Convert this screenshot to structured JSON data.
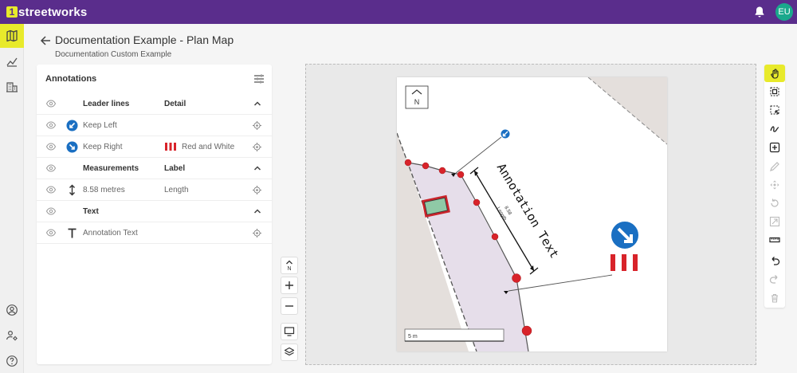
{
  "app": {
    "logo_mark": "1",
    "logo_text": "streetworks",
    "user_initials": "EU",
    "accent": "#5a2d8c",
    "highlight": "#e8ea2b"
  },
  "header": {
    "title": "Documentation Example - Plan Map",
    "subtitle": "Documentation Custom Example"
  },
  "panel": {
    "title": "Annotations",
    "groups": [
      {
        "name": "Leader lines",
        "column": "Detail",
        "items": [
          {
            "icon": "keep-left-sign-icon",
            "label": "Keep Left",
            "detail": ""
          },
          {
            "icon": "keep-right-sign-icon",
            "label": "Keep Right",
            "detail": "Red and White"
          }
        ]
      },
      {
        "name": "Measurements",
        "column": "Label",
        "items": [
          {
            "icon": "measure-icon",
            "label": "8.58 metres",
            "detail": "Length"
          }
        ]
      },
      {
        "name": "Text",
        "column": "",
        "items": [
          {
            "icon": "text-icon",
            "label": "Annotation Text",
            "detail": ""
          }
        ]
      }
    ]
  },
  "map": {
    "north_label": "N",
    "annotation_text": "Annotation Text",
    "measure_value": "8.58",
    "measure_label": "Length",
    "scale_label": "5 m"
  },
  "map_controls": {
    "north_label": "N"
  }
}
